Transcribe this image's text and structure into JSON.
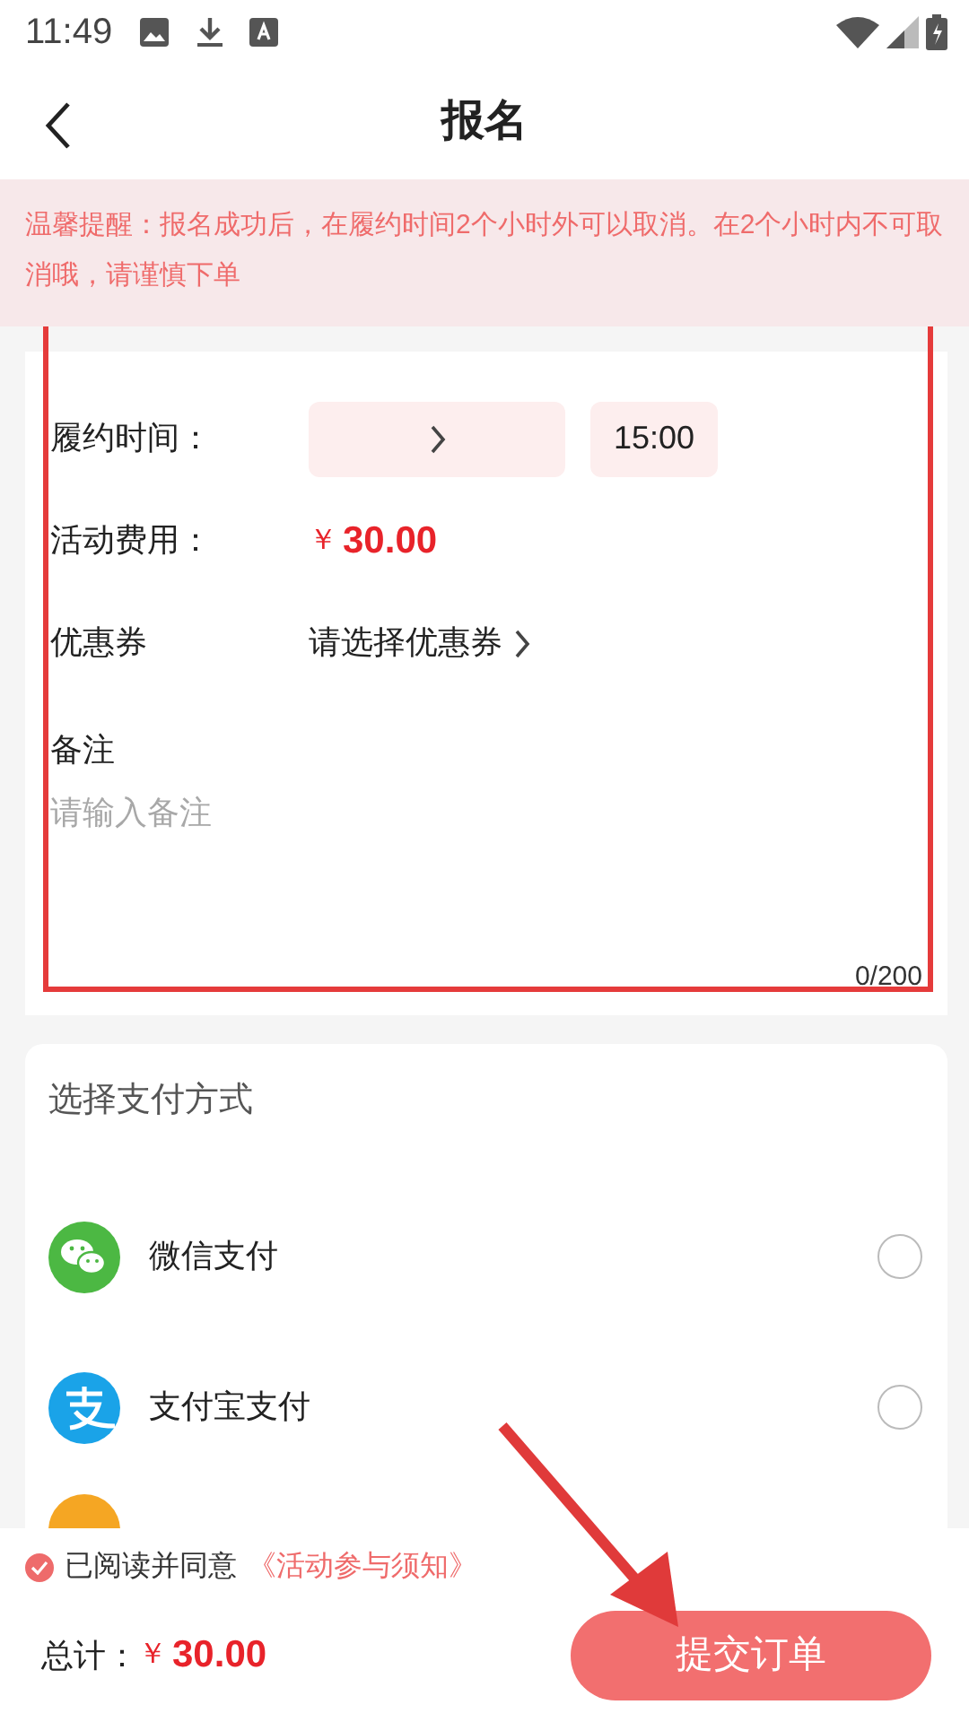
{
  "status_bar": {
    "time": "11:49"
  },
  "header": {
    "title": "报名"
  },
  "notice": "温馨提醒：报名成功后，在履约时间2个小时外可以取消。在2个小时内不可取消哦，请谨慎下单",
  "form": {
    "fields": [
      {
        "kind": "datetime",
        "label": "履约时间：",
        "time": "15:00"
      },
      {
        "kind": "price",
        "label": "活动费用：",
        "currency": "￥",
        "amount": "30.00"
      },
      {
        "kind": "select",
        "label": "优惠券",
        "value": "请选择优惠券"
      },
      {
        "kind": "textarea",
        "label": "备注",
        "placeholder": "请输入备注",
        "counter": "0/200"
      }
    ]
  },
  "payment": {
    "title": "选择支付方式",
    "methods": [
      {
        "kind": "wechat",
        "label": "微信支付",
        "selected": false
      },
      {
        "kind": "alipay",
        "label": "支付宝支付",
        "selected": false
      },
      {
        "kind": "other"
      }
    ]
  },
  "footer": {
    "agreement": {
      "checked": true,
      "text": "已阅读并同意",
      "link": "《活动参与须知》"
    },
    "total": {
      "label": "总计：",
      "currency": "￥",
      "amount": "30.00"
    },
    "submit": "提交订单"
  },
  "annotations": {
    "highlight_box": true,
    "arrow": true
  }
}
